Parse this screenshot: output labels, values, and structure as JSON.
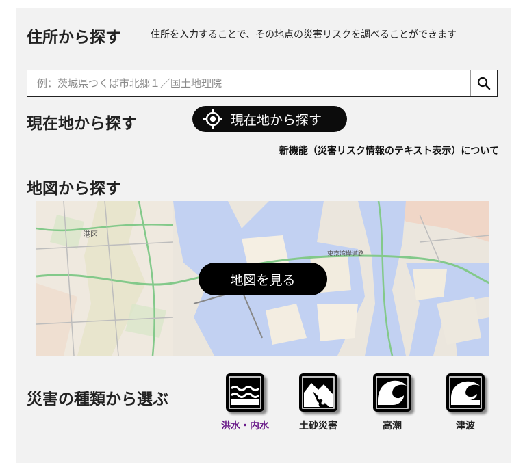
{
  "address": {
    "heading": "住所から探す",
    "description": "住所を入力することで、その地点の災害リスクを調べることができます",
    "placeholder": "例：茨城県つくば市北郷１／国土地理院"
  },
  "location": {
    "heading": "現在地から探す",
    "button_label": "現在地から探す"
  },
  "new_feature_link": "新機能（災害リスク情報のテキスト表示）について",
  "map": {
    "heading": "地図から探す",
    "button_label": "地図を見る",
    "labels": [
      "港区",
      "東京湾岸道路"
    ]
  },
  "disasters": {
    "heading": "災害の種類から選ぶ",
    "items": [
      {
        "label": "洪水・内水",
        "icon": "flood-icon"
      },
      {
        "label": "土砂災害",
        "icon": "landslide-icon"
      },
      {
        "label": "高潮",
        "icon": "storm-surge-icon"
      },
      {
        "label": "津波",
        "icon": "tsunami-icon"
      }
    ]
  },
  "colors": {
    "accent_active": "#6a1b8a",
    "button_bg": "#0c0c0c",
    "water": "#c2d1f2"
  }
}
